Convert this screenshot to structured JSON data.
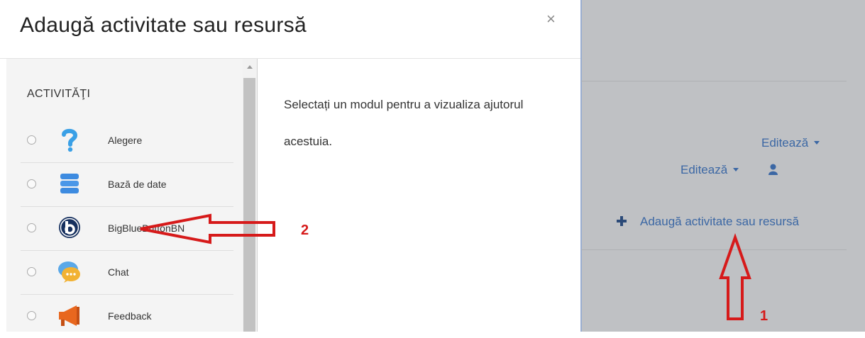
{
  "modal": {
    "title": "Adaugă activitate sau resursă",
    "close_symbol": "×",
    "section_heading": "ACTIVITĂŢI",
    "modules": [
      {
        "label": "Alegere",
        "icon": "question-icon"
      },
      {
        "label": "Bază de date",
        "icon": "database-icon"
      },
      {
        "label": "BigBlueButtonBN",
        "icon": "bigbluebutton-icon"
      },
      {
        "label": "Chat",
        "icon": "chat-icon"
      },
      {
        "label": "Feedback",
        "icon": "megaphone-icon"
      }
    ],
    "info_text": "Selectați un modul pentru a vizualiza ajutorul acestuia."
  },
  "page": {
    "edit_label_1": "Editează",
    "edit_label_2": "Editează",
    "add_activity_label": "Adaugă activitate sau resursă"
  },
  "annotations": {
    "marker_1": "1",
    "marker_2": "2",
    "color": "#d61a1a"
  },
  "colors": {
    "link": "#3b67a4",
    "page_bg": "#bfc1c4"
  }
}
